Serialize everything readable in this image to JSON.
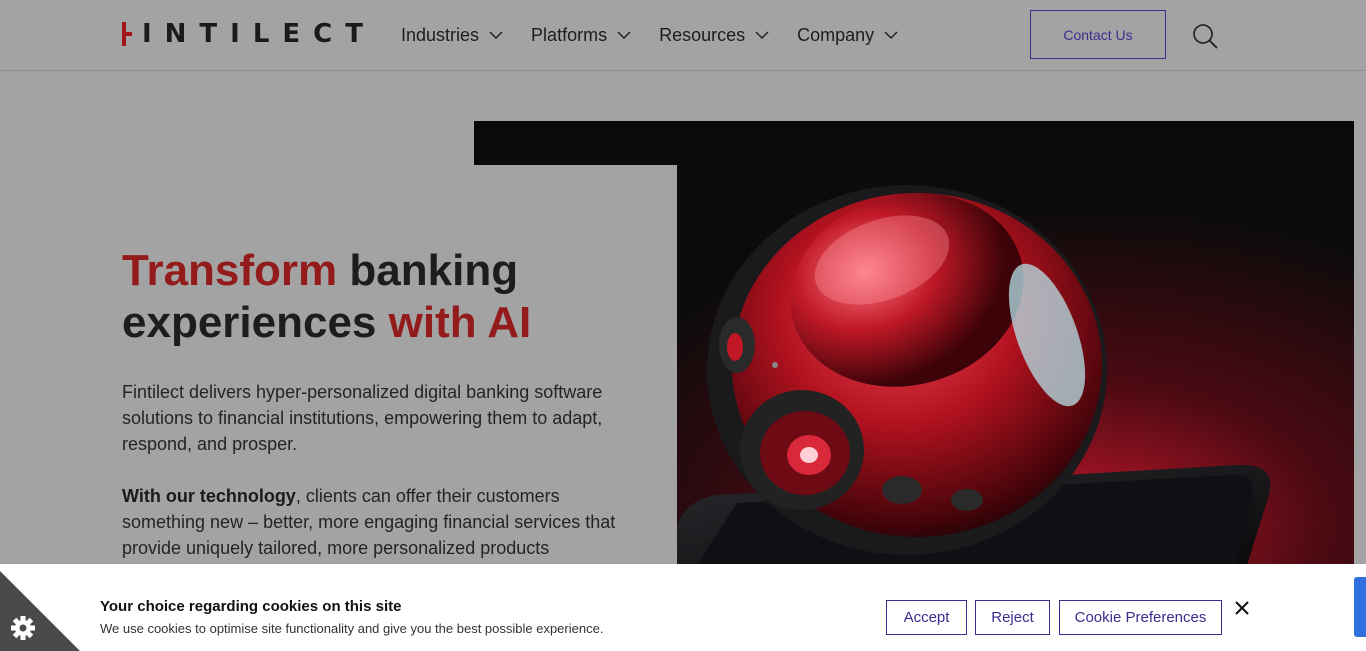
{
  "header": {
    "logo_text": "INTILECT",
    "nav": [
      {
        "label": "Industries"
      },
      {
        "label": "Platforms"
      },
      {
        "label": "Resources"
      },
      {
        "label": "Company"
      }
    ],
    "contact_label": "Contact Us",
    "search_icon": "search-icon"
  },
  "hero": {
    "headline_red_1": "Transform",
    "headline_dark_1": " banking",
    "headline_dark_2": "experiences ",
    "headline_red_2": "with AI",
    "paragraph1": "Fintilect delivers hyper-personalized digital banking software solutions to financial institutions, empowering them to adapt, respond, and prosper.",
    "paragraph2_bold": "With our technology",
    "paragraph2_rest": ", clients can offer their customers something new – better, more engaging financial services that provide uniquely tailored, more personalized products"
  },
  "cookie": {
    "title": "Your choice regarding cookies on this site",
    "description": "We use cookies to optimise site functionality and give you the best possible experience.",
    "accept_label": "Accept",
    "reject_label": "Reject",
    "preferences_label": "Cookie Preferences"
  },
  "colors": {
    "brand_red": "#941b1b",
    "accent_purple": "#3d2c8d"
  }
}
